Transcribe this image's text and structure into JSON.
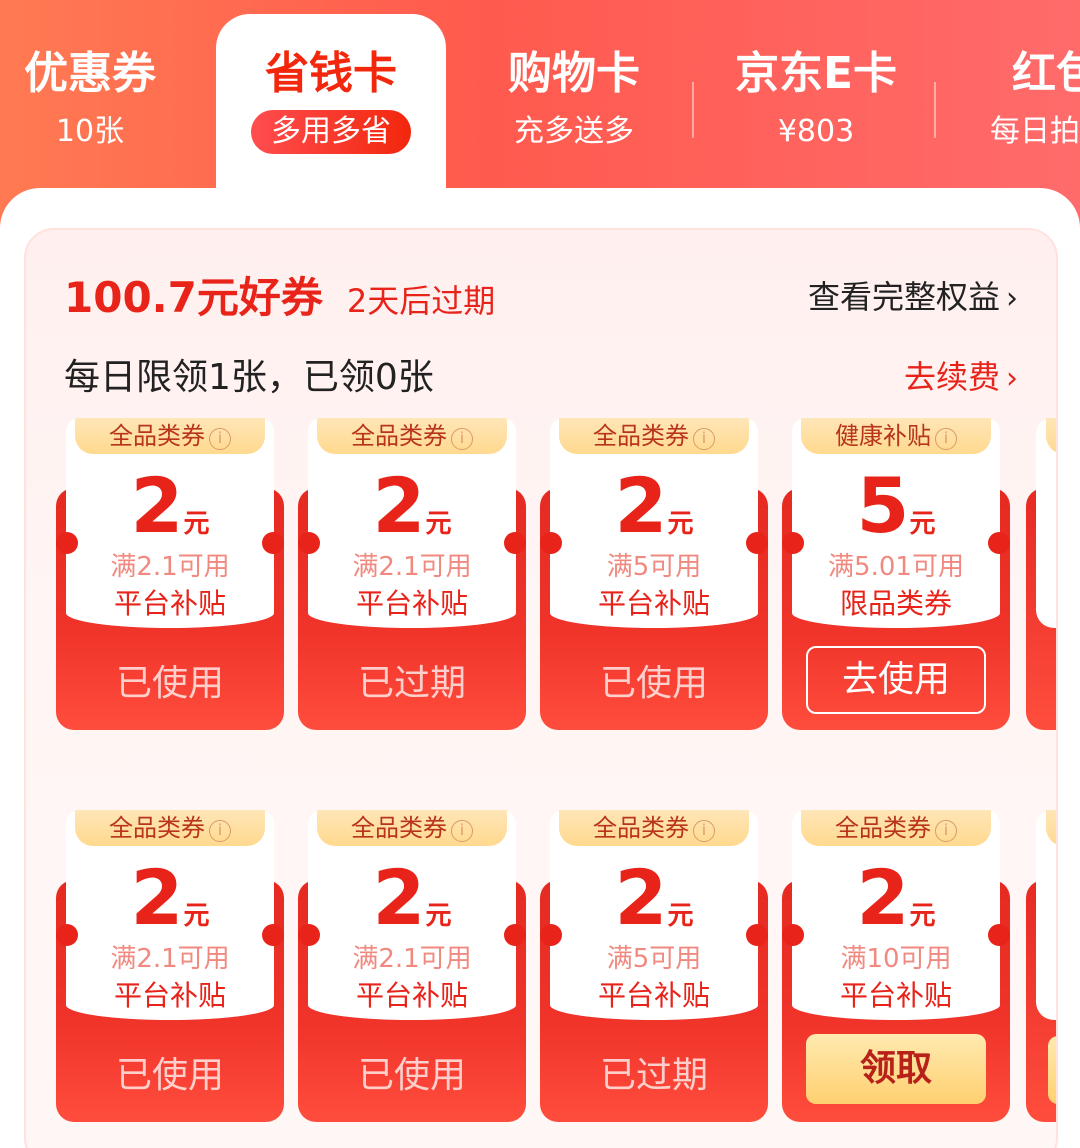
{
  "tabs": [
    {
      "title": "优惠券",
      "sub": "10张"
    },
    {
      "title": "省钱卡",
      "sub": "多用多省"
    },
    {
      "title": "购物卡",
      "sub": "充多送多"
    },
    {
      "title": "京东E卡",
      "sub": "¥803"
    },
    {
      "title": "红包",
      "sub": "每日拍"
    }
  ],
  "header": {
    "title": "100.7元好券",
    "expire": "2天后过期",
    "view_all": "查看完整权益",
    "daily": "每日限领1张，已领0张",
    "renew": "去续费"
  },
  "coupons": [
    {
      "tag": "全品类券",
      "amount": "2",
      "unit": "元",
      "cond": "满2.1可用",
      "type": "平台补贴",
      "action": "已使用"
    },
    {
      "tag": "全品类券",
      "amount": "2",
      "unit": "元",
      "cond": "满2.1可用",
      "type": "平台补贴",
      "action": "已过期"
    },
    {
      "tag": "全品类券",
      "amount": "2",
      "unit": "元",
      "cond": "满5可用",
      "type": "平台补贴",
      "action": "已使用"
    },
    {
      "tag": "健康补贴",
      "amount": "5",
      "unit": "元",
      "cond": "满5.01可用",
      "type": "限品类券",
      "action": "去使用"
    },
    {
      "tag": "全品类券",
      "amount": "2",
      "unit": "元",
      "cond": "满2.1可用",
      "type": "平台补贴",
      "action": "已使用"
    },
    {
      "tag": "全品类券",
      "amount": "2",
      "unit": "元",
      "cond": "满2.1可用",
      "type": "平台补贴",
      "action": "已使用"
    },
    {
      "tag": "全品类券",
      "amount": "2",
      "unit": "元",
      "cond": "满5可用",
      "type": "平台补贴",
      "action": "已过期"
    },
    {
      "tag": "全品类券",
      "amount": "2",
      "unit": "元",
      "cond": "满10可用",
      "type": "平台补贴",
      "action": "领取"
    }
  ],
  "icons": {
    "info": "info-icon",
    "chevron": "chevron-right-icon"
  },
  "colors": {
    "accent": "#f2270c",
    "gold": "#ffd98e"
  }
}
